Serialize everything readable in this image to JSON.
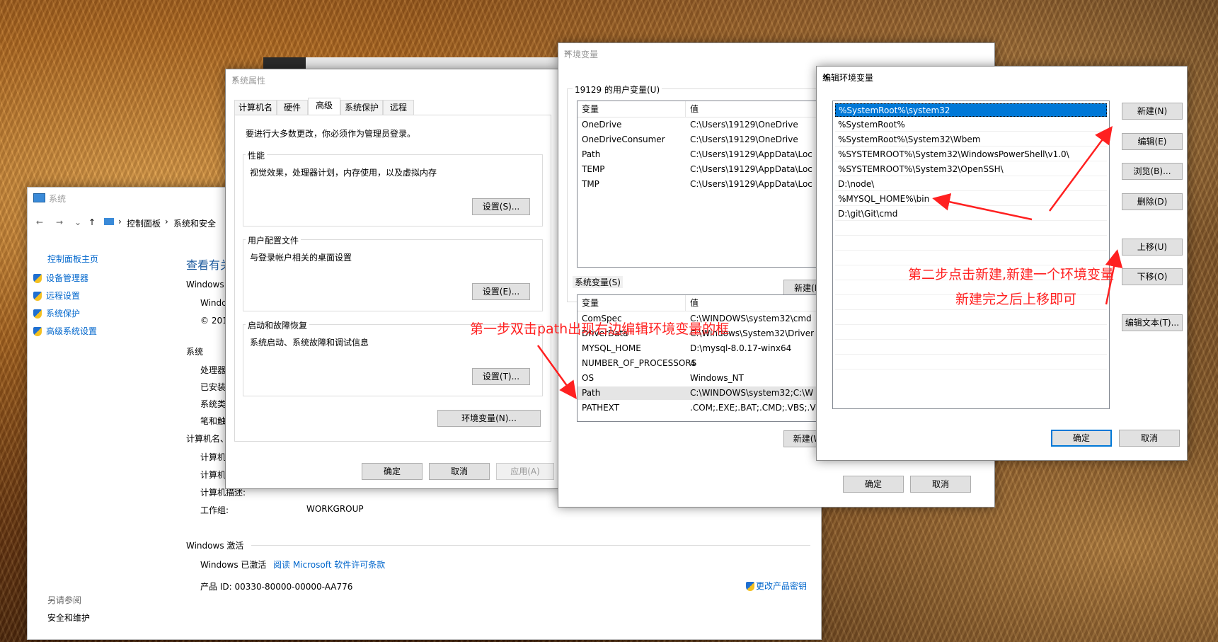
{
  "system_window": {
    "title": "系统",
    "breadcrumb": [
      "控制面板",
      "系统和安全"
    ],
    "sidebar_home": "控制面板主页",
    "sidebar_items": [
      "设备管理器",
      "远程设置",
      "系统保护",
      "高级系统设置"
    ],
    "main_heading": "查看有关",
    "windows_edition_label": "Windows",
    "windows_name_partial": "Windc",
    "copyright_partial": "© 201",
    "system_section": "系统",
    "system_rows": [
      "处理器",
      "已安装",
      "系统类",
      "笔和触"
    ],
    "computer_section": "计算机名、",
    "computer_rows": [
      "计算机",
      "计算机"
    ],
    "computer_desc_label": "计算机描述:",
    "workgroup_label": "工作组:",
    "workgroup_value": "WORKGROUP",
    "activation_section": "Windows 激活",
    "activation_status": "Windows 已激活",
    "license_link": "阅读 Microsoft 软件许可条款",
    "product_id": "产品 ID: 00330-80000-00000-AA776",
    "change_key": "更改产品密钥",
    "see_also": "另请参阅",
    "security_link": "安全和维护"
  },
  "sysprops": {
    "title": "系统属性",
    "tabs": [
      "计算机名",
      "硬件",
      "高级",
      "系统保护",
      "远程"
    ],
    "admin_note": "要进行大多数更改，你必须作为管理员登录。",
    "perf_label": "性能",
    "perf_desc": "视觉效果，处理器计划，内存使用，以及虚拟内存",
    "perf_btn": "设置(S)...",
    "profile_label": "用户配置文件",
    "profile_desc": "与登录帐户相关的桌面设置",
    "profile_btn": "设置(E)...",
    "startup_label": "启动和故障恢复",
    "startup_desc": "系统启动、系统故障和调试信息",
    "startup_btn": "设置(T)...",
    "envvars_btn": "环境变量(N)...",
    "ok": "确定",
    "cancel": "取消",
    "apply": "应用(A)"
  },
  "envvars": {
    "title": "环境变量",
    "user_group": "19129 的用户变量(U)",
    "col_var": "变量",
    "col_val": "值",
    "user_vars": [
      {
        "name": "OneDrive",
        "value": "C:\\Users\\19129\\OneDrive"
      },
      {
        "name": "OneDriveConsumer",
        "value": "C:\\Users\\19129\\OneDrive"
      },
      {
        "name": "Path",
        "value": "C:\\Users\\19129\\AppData\\Loc"
      },
      {
        "name": "TEMP",
        "value": "C:\\Users\\19129\\AppData\\Loc"
      },
      {
        "name": "TMP",
        "value": "C:\\Users\\19129\\AppData\\Loc"
      }
    ],
    "user_new_btn": "新建(N",
    "system_group": "系统变量(S)",
    "system_vars": [
      {
        "name": "ComSpec",
        "value": "C:\\WINDOWS\\system32\\cmd"
      },
      {
        "name": "DriverData",
        "value": "C:\\Windows\\System32\\Driver"
      },
      {
        "name": "MYSQL_HOME",
        "value": "D:\\mysql-8.0.17-winx64"
      },
      {
        "name": "NUMBER_OF_PROCESSORS",
        "value": "4"
      },
      {
        "name": "OS",
        "value": "Windows_NT"
      },
      {
        "name": "Path",
        "value": "C:\\WINDOWS\\system32;C:\\W"
      },
      {
        "name": "PATHEXT",
        "value": ".COM;.EXE;.BAT;.CMD;.VBS;.V"
      }
    ],
    "system_new_btn": "新建(W",
    "ok": "确定",
    "cancel": "取消"
  },
  "editenv": {
    "title": "编辑环境变量",
    "entries": [
      "%SystemRoot%\\system32",
      "%SystemRoot%",
      "%SystemRoot%\\System32\\Wbem",
      "%SYSTEMROOT%\\System32\\WindowsPowerShell\\v1.0\\",
      "%SYSTEMROOT%\\System32\\OpenSSH\\",
      "D:\\node\\",
      "%MYSQL_HOME%\\bin",
      "D:\\git\\Git\\cmd"
    ],
    "btn_new": "新建(N)",
    "btn_edit": "编辑(E)",
    "btn_browse": "浏览(B)...",
    "btn_delete": "删除(D)",
    "btn_up": "上移(U)",
    "btn_down": "下移(O)",
    "btn_edit_text": "编辑文本(T)...",
    "ok": "确定",
    "cancel": "取消"
  },
  "annotations": {
    "step1": "第一步双击path出现右边编辑环境变量的框",
    "step2_line1": "第二步点击新建,新建一个环境变量",
    "step2_line2": "新建完之后上移即可"
  },
  "colors": {
    "annotation": "#ff2020",
    "selection": "#0078d7",
    "link": "#0066cc"
  }
}
